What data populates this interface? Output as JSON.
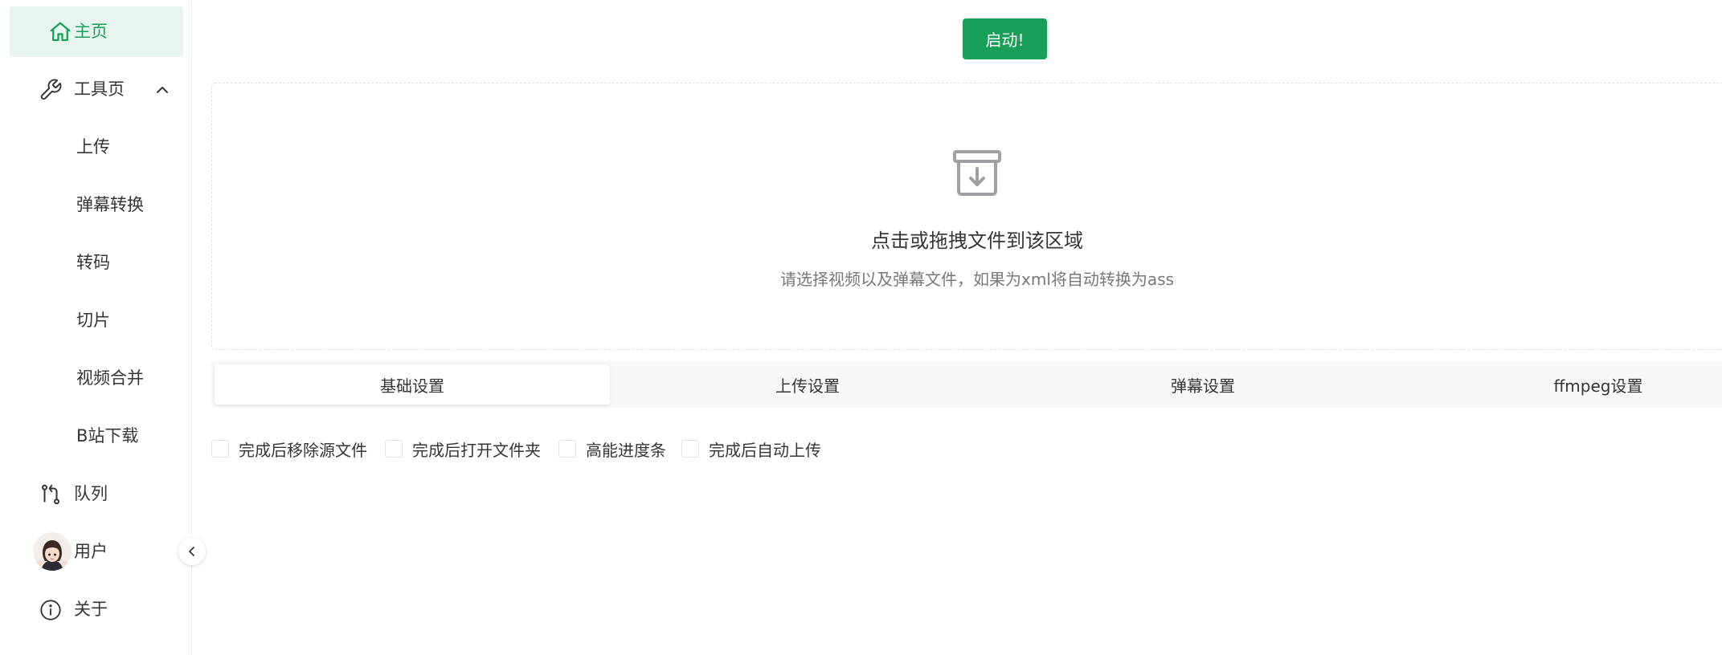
{
  "sidebar": {
    "items": [
      {
        "label": "主页",
        "icon": "home-icon",
        "active": true
      },
      {
        "label": "工具页",
        "icon": "wrench-icon",
        "expanded": true
      },
      {
        "label": "上传"
      },
      {
        "label": "弹幕转换"
      },
      {
        "label": "转码"
      },
      {
        "label": "切片"
      },
      {
        "label": "视频合并"
      },
      {
        "label": "B站下载"
      },
      {
        "label": "队列",
        "icon": "git-compare-icon"
      },
      {
        "label": "用户",
        "icon": "avatar"
      },
      {
        "label": "关于",
        "icon": "info-icon"
      }
    ]
  },
  "main": {
    "start_button": "启动!",
    "dropzone": {
      "title": "点击或拖拽文件到该区域",
      "hint": "请选择视频以及弹幕文件，如果为xml将自动转换为ass",
      "icon": "archive-download-icon"
    },
    "tabs": [
      {
        "label": "基础设置",
        "active": true
      },
      {
        "label": "上传设置"
      },
      {
        "label": "弹幕设置"
      },
      {
        "label": "ffmpeg设置"
      }
    ],
    "checkboxes": [
      {
        "label": "完成后移除源文件",
        "checked": false
      },
      {
        "label": "完成后打开文件夹",
        "checked": false
      },
      {
        "label": "高能进度条",
        "checked": false
      },
      {
        "label": "完成后自动上传",
        "checked": false
      }
    ]
  },
  "colors": {
    "accent": "#18a058",
    "active_bg": "#e7f5ee",
    "tab_bg": "#f7f7fa",
    "border": "#e0e0e6",
    "text": "#333639",
    "muted_text": "#76787c"
  }
}
